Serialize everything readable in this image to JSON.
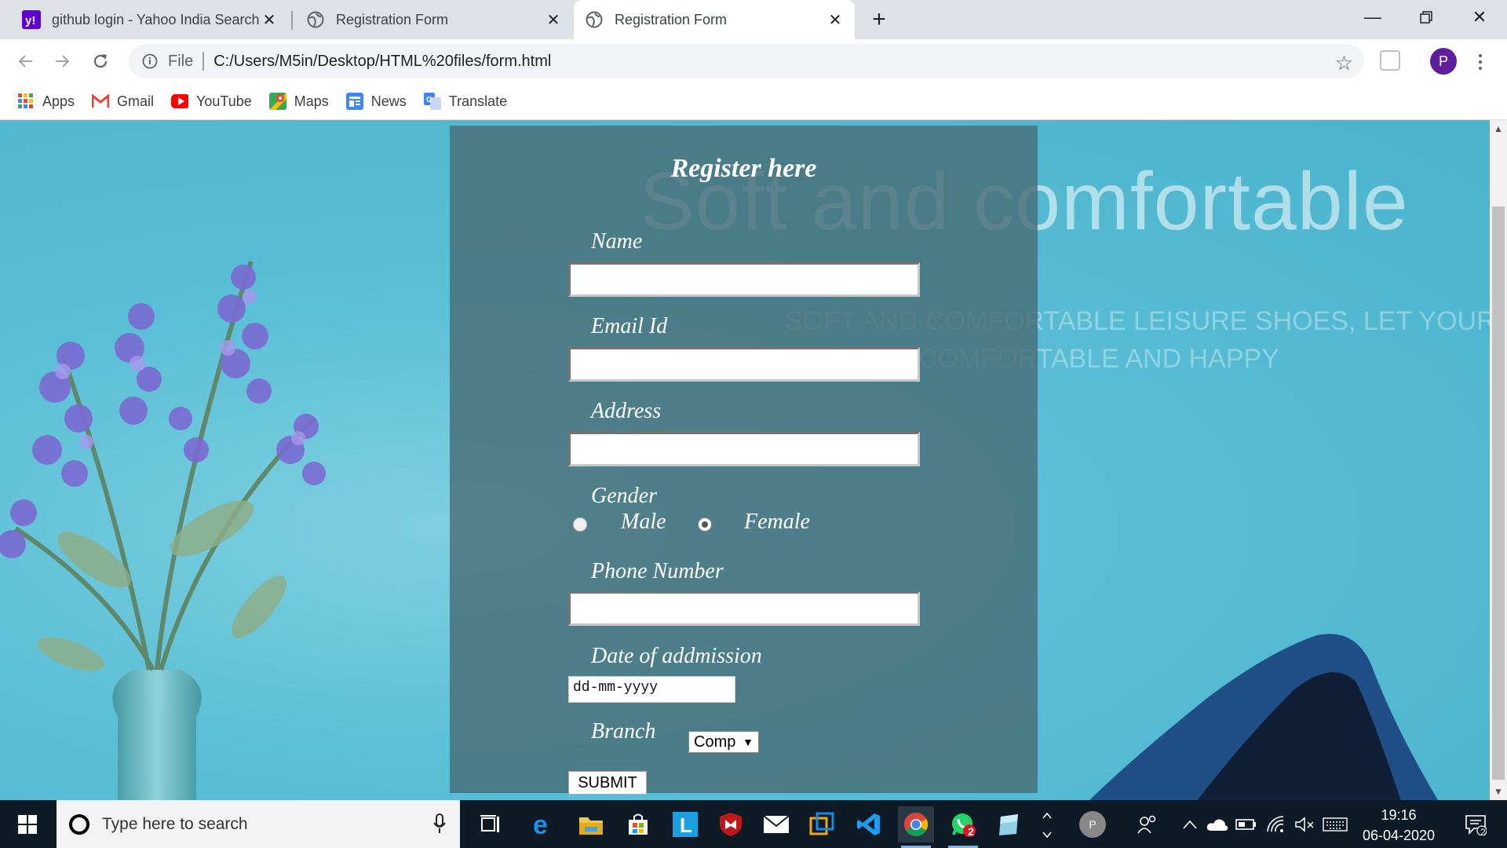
{
  "browser": {
    "tabs": [
      {
        "title": "github login - Yahoo India Search",
        "icon": "yahoo-icon",
        "active": false
      },
      {
        "title": "Registration Form",
        "icon": "globe-icon",
        "active": false
      },
      {
        "title": "Registration Form",
        "icon": "globe-icon",
        "active": true
      }
    ],
    "address": {
      "scheme_label": "File",
      "url": "C:/Users/M5in/Desktop/HTML%20files/form.html"
    },
    "profile_initial": "P",
    "bookmarks": [
      {
        "label": "Apps",
        "icon": "apps-grid-icon"
      },
      {
        "label": "Gmail",
        "icon": "gmail-icon"
      },
      {
        "label": "YouTube",
        "icon": "youtube-icon"
      },
      {
        "label": "Maps",
        "icon": "maps-icon"
      },
      {
        "label": "News",
        "icon": "news-icon"
      },
      {
        "label": "Translate",
        "icon": "translate-icon"
      }
    ]
  },
  "page": {
    "hero_title": "Soft and comfortable",
    "hero_subtitle_line1": "SOFT AND COMFORTABLE LEISURE SHOES, LET YOUR LIFE",
    "hero_subtitle_line2": "COMFORTABLE AND HAPPY",
    "form": {
      "title": "Register here",
      "name_label": "Name",
      "email_label": "Email Id",
      "address_label": "Address",
      "gender_label": "Gender",
      "gender_options": [
        "Male",
        "Female"
      ],
      "gender_selected": "Female",
      "phone_label": "Phone Number",
      "date_label": "Date of addmission",
      "date_placeholder": "dd-mm-yyyy",
      "branch_label": "Branch",
      "branch_selected": "Comp",
      "submit_label": "SUBMIT"
    }
  },
  "taskbar": {
    "search_placeholder": "Type here to search",
    "whatsapp_badge": "2",
    "tray_profile_initial": "P",
    "time": "19:16",
    "date": "06-04-2020",
    "notification_count": "2"
  },
  "colors": {
    "form_panel": "#486e78",
    "page_bg": "#5bbfd6",
    "profile": "#5e1e9e",
    "taskbar": "#0e1a26"
  }
}
